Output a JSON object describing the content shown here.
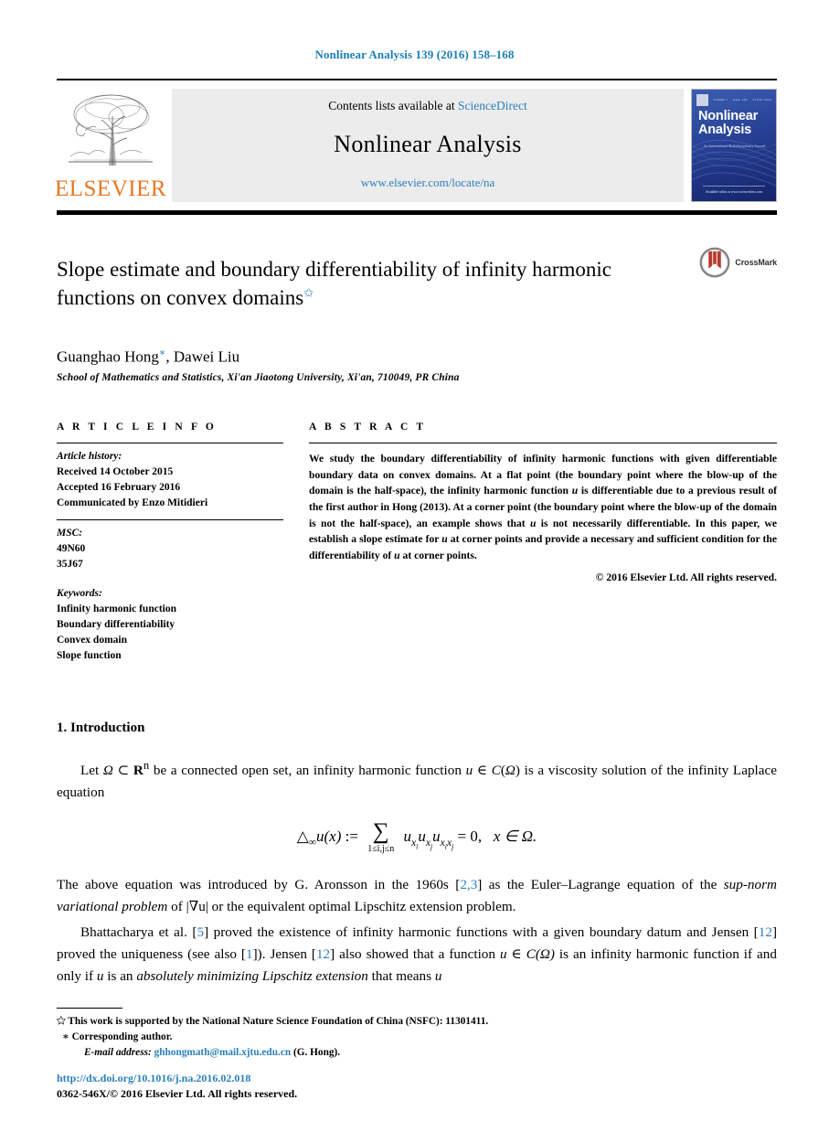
{
  "running_head": "Nonlinear Analysis 139 (2016) 158–168",
  "masthead": {
    "publisher_name": "ELSEVIER",
    "contents_prefix": "Contents lists available at ",
    "contents_link": "ScienceDirect",
    "journal_name": "Nonlinear Analysis",
    "journal_url": "www.elsevier.com/locate/na",
    "cover": {
      "title_line1": "Nonlinear",
      "title_line2": "Analysis",
      "meta_left": "Volume 7",
      "meta_mid": "Issue 139",
      "meta_right": "15 Feb 2016",
      "subtitle_lines": "An International Multidisciplinary Journal",
      "footer": "Available online at www.sciencedirect.com"
    }
  },
  "article": {
    "title": "Slope estimate and boundary differentiability of infinity harmonic functions on convex domains",
    "title_footnote_mark": "✩",
    "authors": "Guanghao Hong",
    "author_cor_mark": "∗",
    "authors_rest": ", Dawei Liu",
    "affiliation": "School of Mathematics and Statistics, Xi'an Jiaotong University, Xi'an, 710049, PR China",
    "crossmark_label": "CrossMark"
  },
  "article_info": {
    "heading": "A R T I C L E   I N F O",
    "history_label": "Article history:",
    "history": [
      "Received 14 October 2015",
      "Accepted 16 February 2016",
      "Communicated by Enzo Mitidieri"
    ],
    "msc_label": "MSC:",
    "msc": [
      "49N60",
      "35J67"
    ],
    "keywords_label": "Keywords:",
    "keywords": [
      "Infinity harmonic function",
      "Boundary differentiability",
      "Convex domain",
      "Slope function"
    ]
  },
  "abstract": {
    "heading": "A B S T R A C T",
    "text_1": "We study the boundary differentiability of infinity harmonic functions with given differentiable boundary data on convex domains. At a flat point (the boundary point where the blow-up of the domain is the half-space), the infinity harmonic function ",
    "u_1": "u",
    "text_2": " is differentiable due to a previous result of the first author in Hong (2013). At a corner point (the boundary point where the blow-up of the domain is not the half-space), an example shows that ",
    "u_2": "u",
    "text_3": " is not necessarily differentiable. In this paper, we establish a slope estimate for ",
    "u_3": "u",
    "text_4": " at corner points and provide a necessary and sufficient condition for the differentiability of ",
    "u_4": "u",
    "text_5": " at corner points.",
    "copyright": "© 2016 Elsevier Ltd. All rights reserved."
  },
  "section": {
    "heading": "1. Introduction",
    "p1_a": "Let ",
    "p1_omega": "Ω",
    "p1_b": " ⊂ ",
    "p1_rn": "R",
    "p1_rn_sup": "n",
    "p1_c": " be a connected open set, an infinity harmonic function ",
    "p1_u": "u",
    "p1_d": " ∈ ",
    "p1_c_of": "C",
    "p1_e": "(",
    "p1_omega2": "Ω",
    "p1_f": ") is a viscosity solution of the infinity Laplace equation",
    "equation": {
      "lhs_delta": "△",
      "lhs_sub": "∞",
      "lhs_u": "u",
      "lhs_arg": "(x)",
      "assign": ":=",
      "sum_glyph": "∑",
      "sum_limits": "1≤i,j≤n",
      "terms": "u",
      "t1_sub": "x",
      "t1_subsub": "i",
      "t2_sub": "x",
      "t2_subsub": "j",
      "t3_sub": "x",
      "t3_subsub": "i",
      "t3_subsub2": "x",
      "t3_subsub3": "j",
      "rhs": "= 0,",
      "domain_cond": "x ∈ Ω."
    },
    "p2_a": "The above equation was introduced by G. Aronsson in the 1960s [",
    "p2_ref1": "2,3",
    "p2_b": "] as the Euler–Lagrange equation of the ",
    "p2_it": "sup-norm variational problem",
    "p2_c": " of |∇u| or the equivalent optimal Lipschitz extension problem.",
    "p3_a": "Bhattacharya et al. [",
    "p3_ref1": "5",
    "p3_b": "] proved the existence of infinity harmonic functions with a given boundary datum and Jensen [",
    "p3_ref2": "12",
    "p3_c": "] proved the uniqueness (see also [",
    "p3_ref3": "1",
    "p3_d": "]). Jensen [",
    "p3_ref4": "12",
    "p3_e": "] also showed that a function ",
    "p3_u": "u",
    "p3_f": " ∈ ",
    "p3_cofomega": "C(Ω)",
    "p3_g": " is an infinity harmonic function if and only if ",
    "p3_u2": "u",
    "p3_h": " is an ",
    "p3_it": "absolutely minimizing Lipschitz extension",
    "p3_i": " that means ",
    "p3_u3": "u"
  },
  "footnotes": {
    "fn1_mark": "✩",
    "fn1_text": "This work is supported by the National Nature Science Foundation of China (NSFC): 11301411.",
    "fn2_mark": "∗",
    "fn2_text": "Corresponding author.",
    "fn3_label": "E-mail address:",
    "fn3_email": "ghhongmath@mail.xjtu.edu.cn",
    "fn3_suffix": " (G. Hong)."
  },
  "bottom": {
    "doi": "http://dx.doi.org/10.1016/j.na.2016.02.018",
    "issn_line": "0362-546X/© 2016 Elsevier Ltd. All rights reserved."
  },
  "colors": {
    "link": "#2a7fba",
    "elsevier_orange": "#E87722",
    "cover_blue": "#29459a"
  }
}
